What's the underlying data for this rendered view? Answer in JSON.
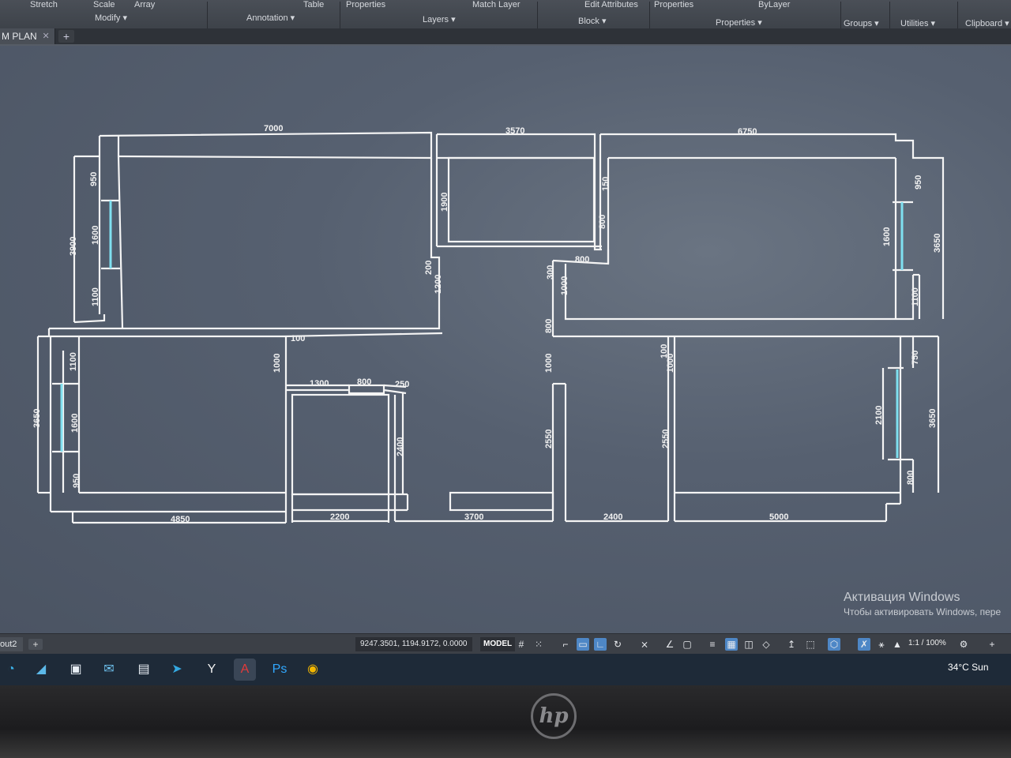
{
  "ribbon": {
    "tools": [
      "Stretch",
      "Scale",
      "Array",
      "Table",
      "Properties",
      "Match Layer",
      "Edit Attributes",
      "Properties",
      "ByLayer"
    ],
    "groups": [
      "Modify",
      "Annotation",
      "Layers",
      "Block",
      "Properties",
      "Groups",
      "Utilities",
      "Clipboard"
    ]
  },
  "file_tab": {
    "label": "M PLAN"
  },
  "plan": {
    "dimensions": {
      "top": [
        "7000",
        "3570",
        "6750"
      ],
      "bottom": [
        "4850",
        "2200",
        "3700",
        "2400",
        "5000"
      ],
      "left_upper": [
        "950",
        "1600",
        "3900",
        "1100"
      ],
      "left_lower": [
        "1100",
        "3650",
        "1600",
        "950"
      ],
      "right_upper": [
        "950",
        "1600",
        "3650",
        "1100"
      ],
      "right_lower": [
        "750",
        "2100",
        "3650",
        "800"
      ],
      "center_a": [
        "1900",
        "200",
        "1200",
        "100",
        "1000"
      ],
      "center_b": [
        "1300",
        "800",
        "250",
        "2400"
      ],
      "center_c": [
        "150",
        "800",
        "300",
        "800",
        "1000",
        "800",
        "1000",
        "2550"
      ],
      "center_d": [
        "100",
        "1000",
        "2550"
      ]
    }
  },
  "watermark": {
    "title": "Активация Windows",
    "subtitle": "Чтобы активировать Windows, пере"
  },
  "status": {
    "layout_tab": "out2",
    "coords": "9247.3501, 1194.9172, 0.0000",
    "model": "MODEL",
    "scale": "1:1 / 100%"
  },
  "taskbar": {
    "temperature": "34°C  Sun"
  },
  "monitor": {
    "brand": "hp"
  }
}
